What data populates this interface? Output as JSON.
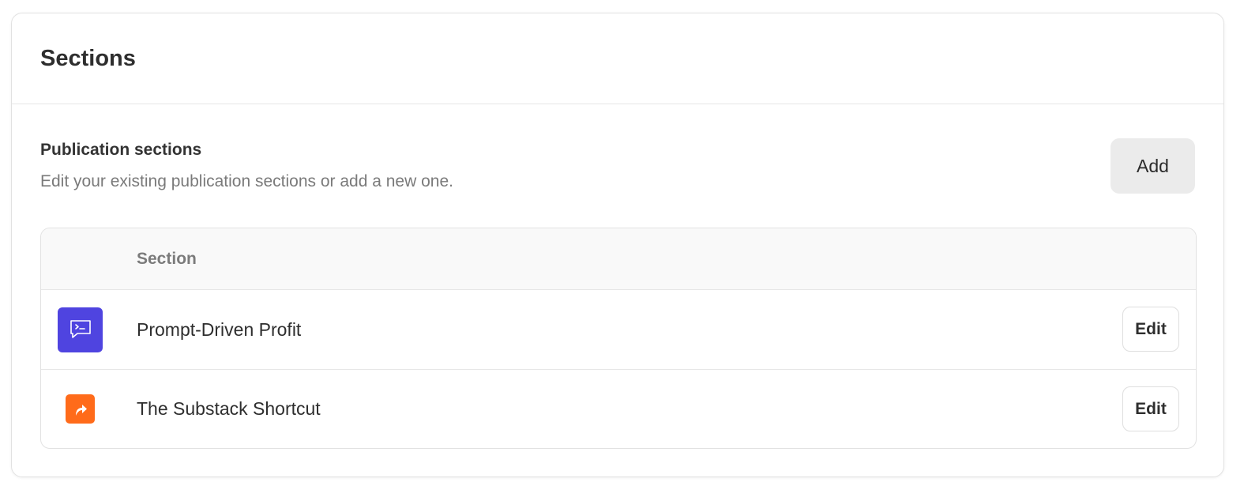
{
  "card": {
    "title": "Sections"
  },
  "publication_sections": {
    "heading": "Publication sections",
    "description": "Edit your existing publication sections or add a new one.",
    "add_label": "Add"
  },
  "table": {
    "column_header": "Section",
    "rows": [
      {
        "label": "Prompt-Driven Profit",
        "icon": "terminal-chat-icon",
        "icon_color": "#4f44e0",
        "edit_label": "Edit"
      },
      {
        "label": "The Substack Shortcut",
        "icon": "shortcut-arrow-icon",
        "icon_color": "#ff6b1a",
        "edit_label": "Edit"
      }
    ]
  }
}
